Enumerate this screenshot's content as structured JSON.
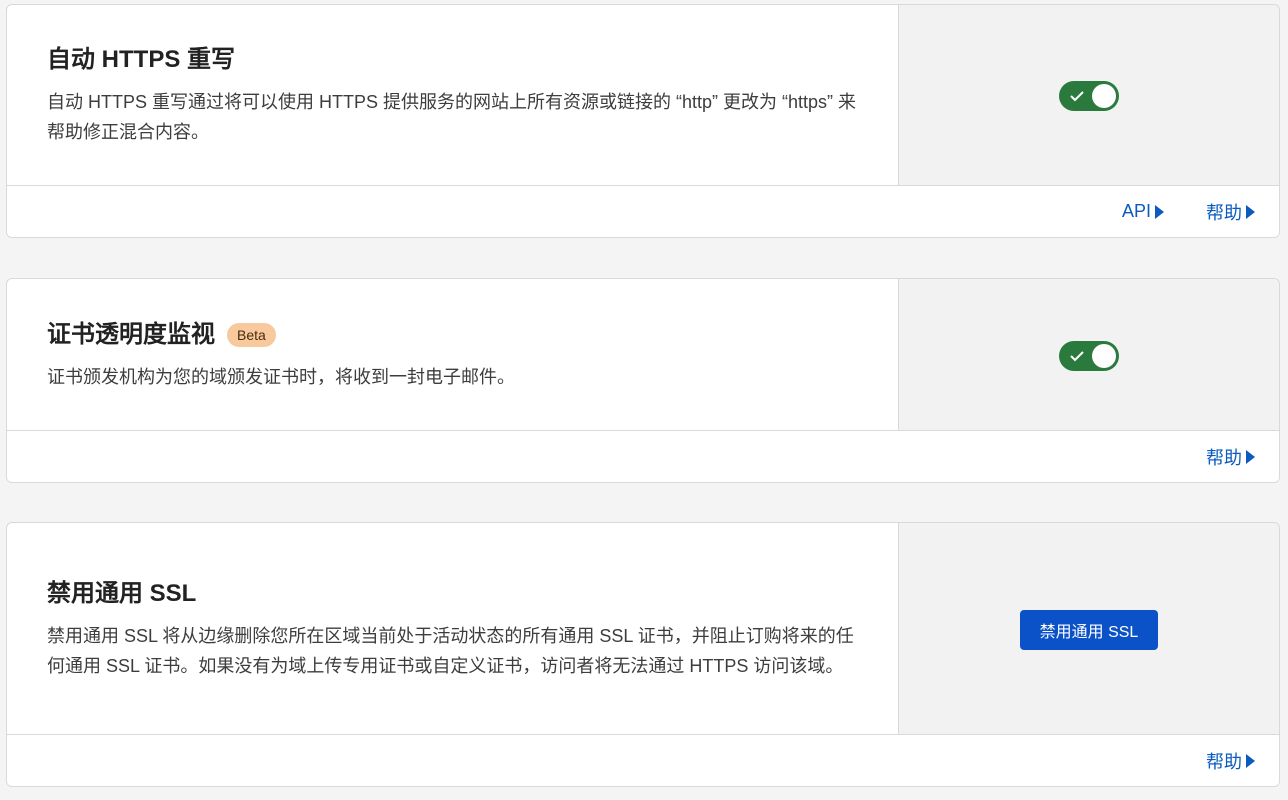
{
  "sections": [
    {
      "title": "自动 HTTPS 重写",
      "description": "自动 HTTPS 重写通过将可以使用 HTTPS 提供服务的网站上所有资源或链接的 “http” 更改为 “https” 来帮助修正混合内容。",
      "toggle_on": true,
      "footer_links": [
        "API",
        "帮助"
      ]
    },
    {
      "title": "证书透明度监视",
      "badge": "Beta",
      "description": "证书颁发机构为您的域颁发证书时，将收到一封电子邮件。",
      "toggle_on": true,
      "footer_links": [
        "帮助"
      ]
    },
    {
      "title": "禁用通用 SSL",
      "description": "禁用通用 SSL 将从边缘删除您所在区域当前处于活动状态的所有通用 SSL 证书，并阻止订购将来的任何通用 SSL 证书。如果没有为域上传专用证书或自定义证书，访问者将无法通过 HTTPS 访问该域。",
      "button_label": "禁用通用 SSL",
      "footer_links": [
        "帮助"
      ]
    }
  ],
  "colors": {
    "toggle_on": "#2b7a3d",
    "link": "#0b5bbf",
    "primary_button": "#0b52c9",
    "badge_bg": "#f8c99c"
  }
}
